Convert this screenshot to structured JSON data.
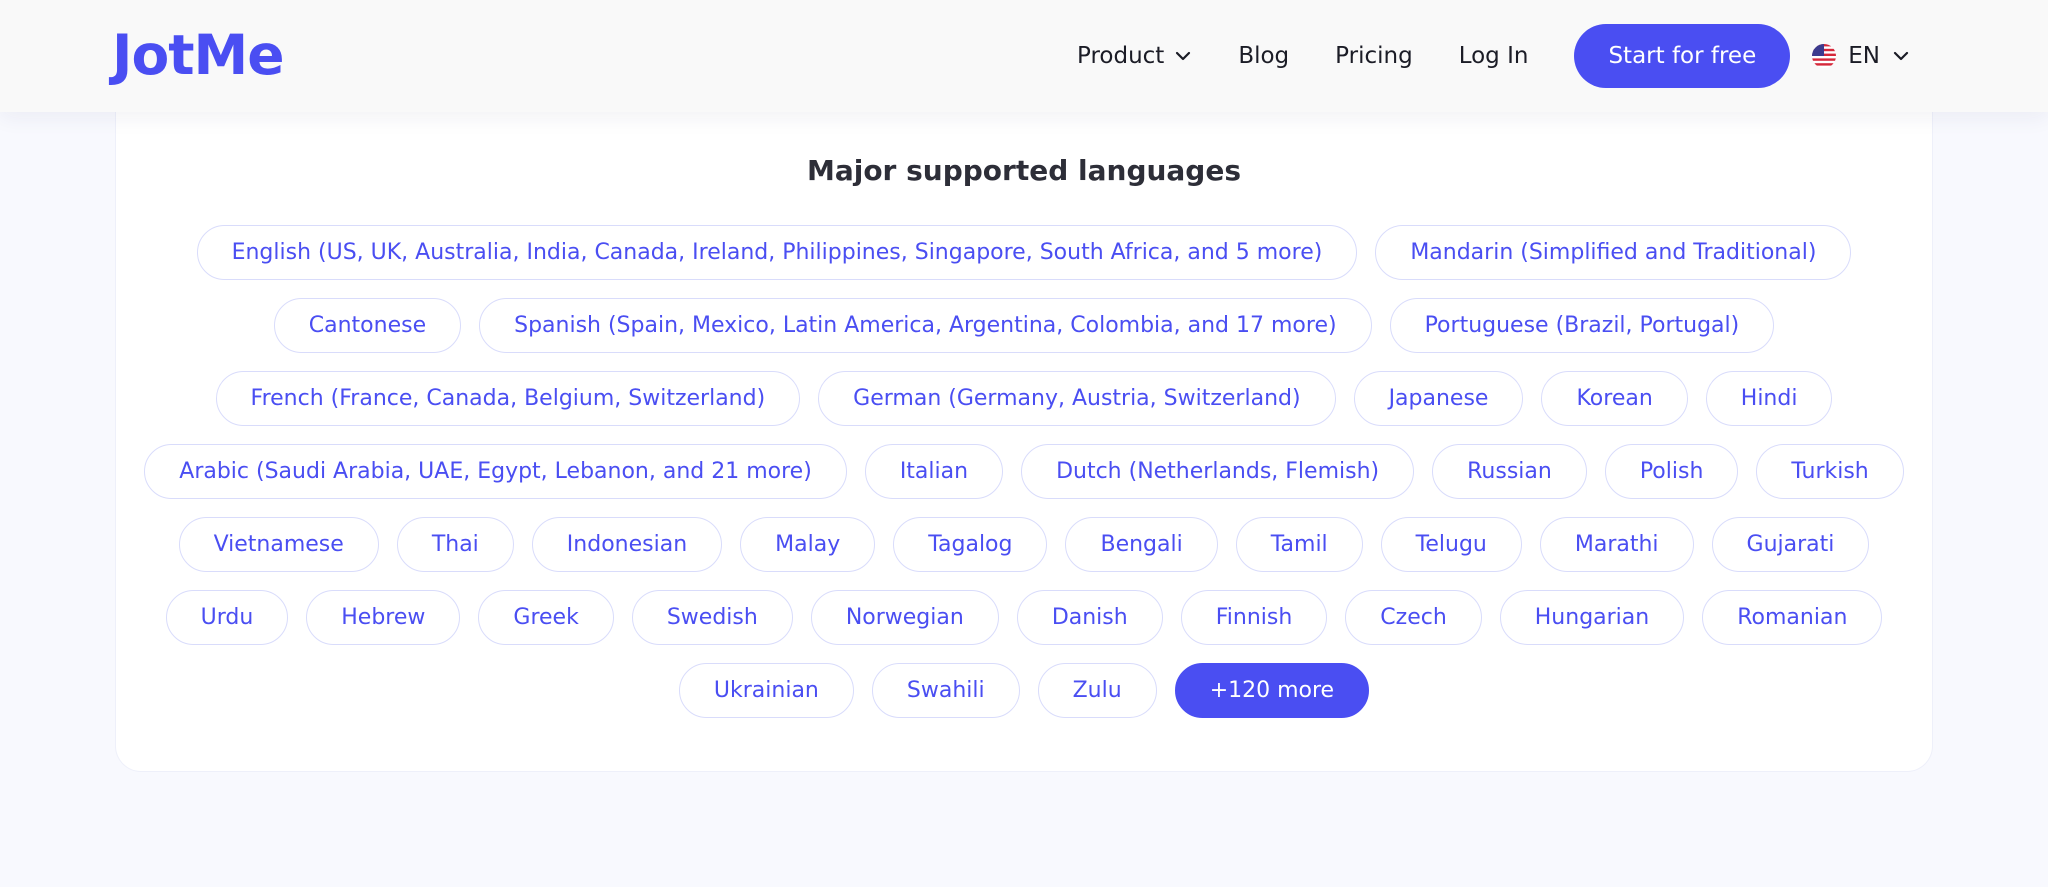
{
  "header": {
    "logo": "JotMe",
    "nav": {
      "product": "Product",
      "blog": "Blog",
      "pricing": "Pricing",
      "login": "Log In"
    },
    "cta": "Start for free",
    "language": "EN"
  },
  "section": {
    "title": "Major supported languages",
    "rows": [
      [
        "English (US, UK, Australia, India, Canada, Ireland, Philippines, Singapore, South Africa, and 5 more)",
        "Mandarin (Simplified and Traditional)"
      ],
      [
        "Cantonese",
        "Spanish (Spain, Mexico, Latin America, Argentina, Colombia, and 17 more)",
        "Portuguese (Brazil, Portugal)"
      ],
      [
        "French (France, Canada, Belgium, Switzerland)",
        "German (Germany, Austria, Switzerland)",
        "Japanese",
        "Korean",
        "Hindi"
      ],
      [
        "Arabic (Saudi Arabia, UAE, Egypt, Lebanon, and 21 more)",
        "Italian",
        "Dutch (Netherlands, Flemish)",
        "Russian",
        "Polish",
        "Turkish"
      ],
      [
        "Vietnamese",
        "Thai",
        "Indonesian",
        "Malay",
        "Tagalog",
        "Bengali",
        "Tamil",
        "Telugu",
        "Marathi",
        "Gujarati"
      ],
      [
        "Urdu",
        "Hebrew",
        "Greek",
        "Swedish",
        "Norwegian",
        "Danish",
        "Finnish",
        "Czech",
        "Hungarian",
        "Romanian"
      ],
      [
        "Ukrainian",
        "Swahili",
        "Zulu"
      ]
    ],
    "more": "+120 more"
  },
  "icons": {
    "dropdown": "chevron-down-icon",
    "flag": "us-flag-icon"
  },
  "colors": {
    "brand": "#4a4ef2",
    "chip_border": "#d9dcfb",
    "page_bg": "#f8f9fe",
    "header_bg": "#f9f9f9"
  }
}
